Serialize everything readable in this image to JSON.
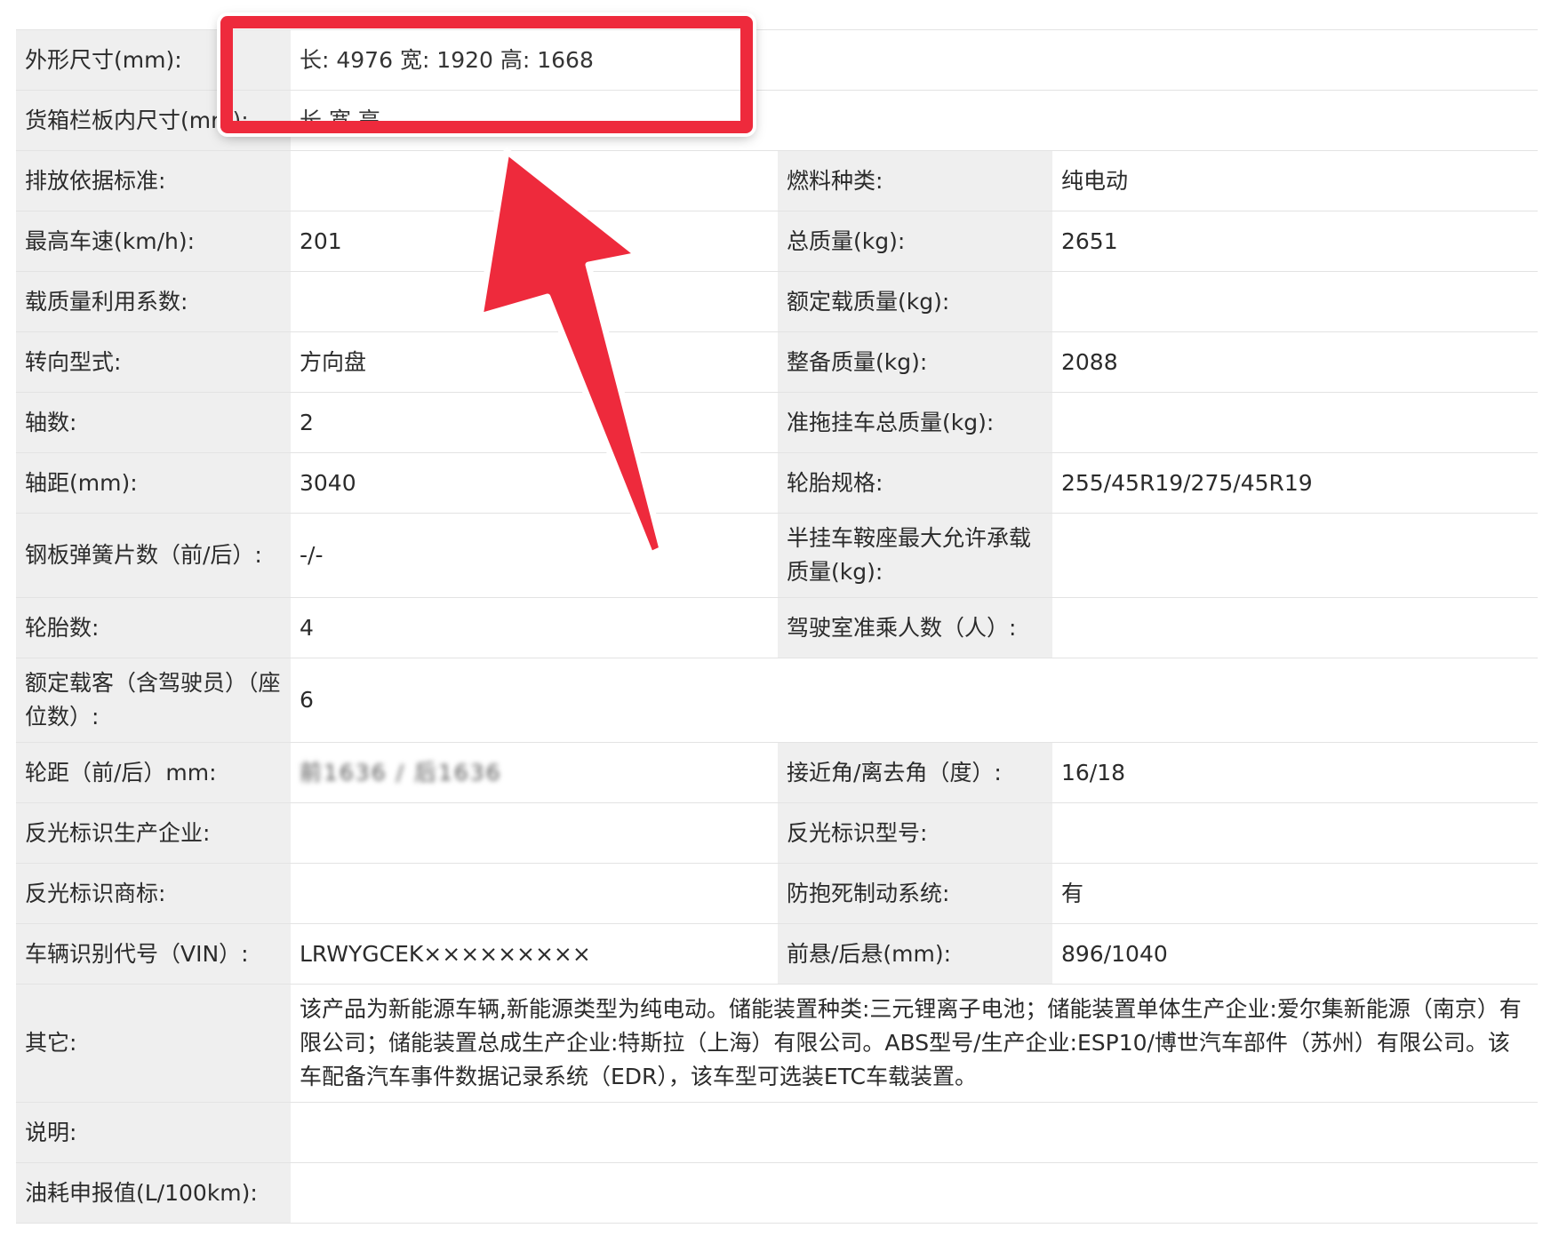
{
  "rows": {
    "dimensions": {
      "label": "外形尺寸(mm):",
      "value": "长: 4976 宽: 1920 高: 1668"
    },
    "cargo_box": {
      "label": "货箱栏板内尺寸(mm):",
      "value": "长 宽 高"
    },
    "emission_standard": {
      "label": "排放依据标准:",
      "value": ""
    },
    "fuel_type": {
      "label": "燃料种类:",
      "value": "纯电动"
    },
    "max_speed": {
      "label": "最高车速(km/h):",
      "value": "201"
    },
    "gross_mass": {
      "label": "总质量(kg):",
      "value": "2651"
    },
    "load_factor": {
      "label": "载质量利用系数:",
      "value": ""
    },
    "rated_load": {
      "label": "额定载质量(kg):",
      "value": ""
    },
    "steering": {
      "label": "转向型式:",
      "value": "方向盘"
    },
    "curb_mass": {
      "label": "整备质量(kg):",
      "value": "2088"
    },
    "axles": {
      "label": "轴数:",
      "value": "2"
    },
    "trailer_mass": {
      "label": "准拖挂车总质量(kg):",
      "value": ""
    },
    "wheelbase": {
      "label": "轴距(mm):",
      "value": "3040"
    },
    "tire_spec": {
      "label": "轮胎规格:",
      "value": "255/45R19/275/45R19"
    },
    "leaf_springs": {
      "label": "钢板弹簧片数（前/后）:",
      "value": "-/-"
    },
    "saddle_load": {
      "label": "半挂车鞍座最大允许承载质量(kg):",
      "value": ""
    },
    "tire_count": {
      "label": "轮胎数:",
      "value": "4"
    },
    "cab_seats": {
      "label": "驾驶室准乘人数（人）:",
      "value": ""
    },
    "rated_passengers": {
      "label": "额定载客（含驾驶员）（座位数）:",
      "value": "6"
    },
    "track": {
      "label": "轮距（前/后）mm:",
      "value": "前1636 / 后1636"
    },
    "approach_departure": {
      "label": "接近角/离去角（度）:",
      "value": "16/18"
    },
    "reflector_maker": {
      "label": "反光标识生产企业:",
      "value": ""
    },
    "reflector_model": {
      "label": "反光标识型号:",
      "value": ""
    },
    "reflector_brand": {
      "label": "反光标识商标:",
      "value": ""
    },
    "abs": {
      "label": "防抱死制动系统:",
      "value": "有"
    },
    "vin": {
      "label": "车辆识别代号（VIN）:",
      "value": "LRWYGCEK×××××××××"
    },
    "overhang": {
      "label": "前悬/后悬(mm):",
      "value": "896/1040"
    },
    "other": {
      "label": "其它:",
      "value": "该产品为新能源车辆,新能源类型为纯电动。储能装置种类:三元锂离子电池；储能装置单体生产企业:爱尔集新能源（南京）有限公司；储能装置总成生产企业:特斯拉（上海）有限公司。ABS型号/生产企业:ESP10/博世汽车部件（苏州）有限公司。该车配备汽车事件数据记录系统（EDR），该车型可选装ETC车载装置。"
    },
    "notes": {
      "label": "说明:",
      "value": ""
    },
    "fuel_consumption": {
      "label": "油耗申报值(L/100km):",
      "value": ""
    }
  },
  "annotation": {
    "highlight_color": "#ee2a3c",
    "arrow_color": "#ee2a3c"
  }
}
